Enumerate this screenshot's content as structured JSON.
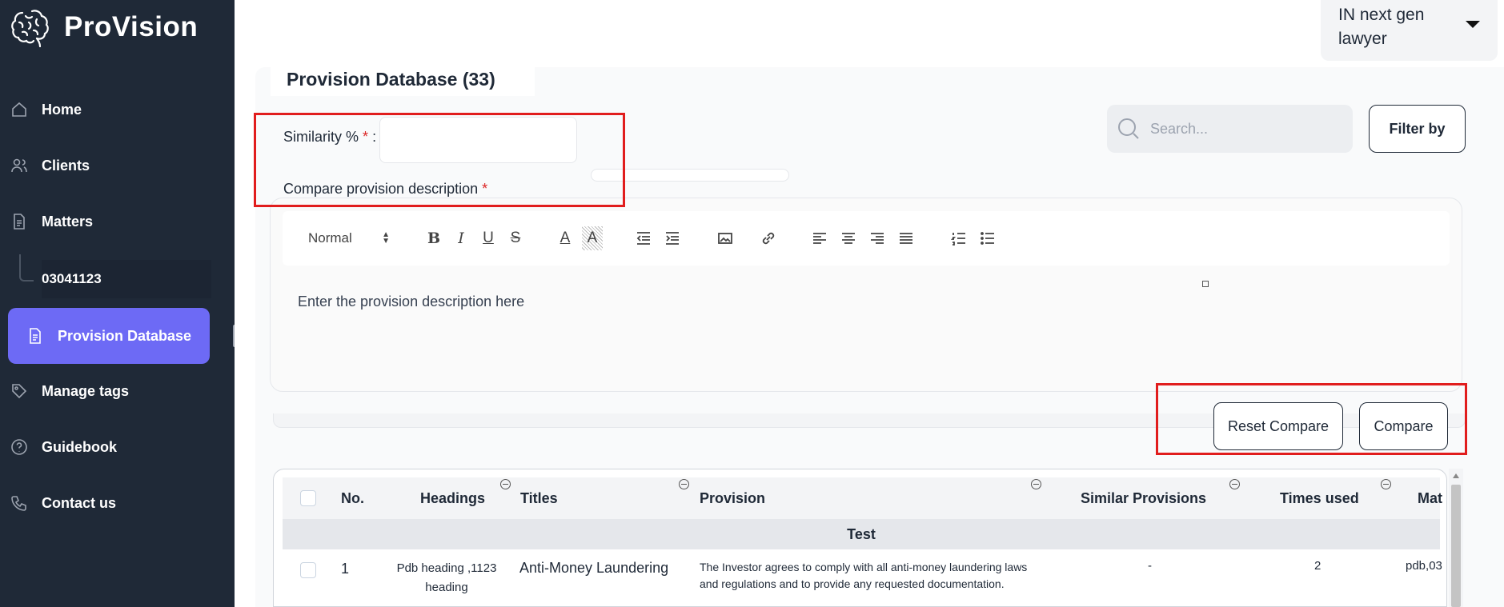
{
  "app": {
    "name": "ProVision"
  },
  "sidebar": {
    "items": [
      {
        "label": "Home",
        "icon": "home-icon"
      },
      {
        "label": "Clients",
        "icon": "users-icon"
      },
      {
        "label": "Matters",
        "icon": "document-icon"
      },
      {
        "label": "03041123",
        "icon": ""
      },
      {
        "label": "Provision Database",
        "icon": "file-icon",
        "active": true
      },
      {
        "label": "Manage tags",
        "icon": "tag-icon"
      },
      {
        "label": "Guidebook",
        "icon": "help-circle-icon"
      },
      {
        "label": "Contact us",
        "icon": "phone-icon"
      }
    ]
  },
  "user": {
    "name": "IN next gen lawyer"
  },
  "page": {
    "title": "Provision Database (33)"
  },
  "search": {
    "placeholder": "Search..."
  },
  "filter": {
    "label": "Filter by"
  },
  "form": {
    "similarity_label": "Similarity %",
    "similarity_colon": ":",
    "required_mark": "*",
    "similarity_value": "",
    "compare_label": "Compare provision description",
    "editor_placeholder": "Enter the provision description here"
  },
  "toolbar": {
    "format_select": "Normal",
    "tools": [
      "bold-icon",
      "italic-icon",
      "underline-icon",
      "strike-icon",
      "text-color-icon",
      "highlight-icon",
      "outdent-icon",
      "indent-icon",
      "image-icon",
      "link-icon",
      "align-left-icon",
      "align-center-icon",
      "align-right-icon",
      "align-justify-icon",
      "ordered-list-icon",
      "bullet-list-icon"
    ]
  },
  "buttons": {
    "reset_compare": "Reset Compare",
    "compare": "Compare"
  },
  "table": {
    "columns": [
      "No.",
      "Headings",
      "Titles",
      "Provision",
      "Similar Provisions",
      "Times used",
      "Mat"
    ],
    "group": "Test",
    "rows": [
      {
        "no": "1",
        "headings": "Pdb heading ,1123 heading",
        "title": "Anti-Money Laundering",
        "provision": "The Investor agrees to comply with all anti-money laundering laws and regulations and to provide any requested documentation.",
        "similar": "-",
        "times_used": "2",
        "matters": "pdb,03"
      }
    ]
  },
  "colors": {
    "sidebar_bg": "#1f2937",
    "active_bg": "#6d6af5",
    "highlight": "#e11d1d"
  }
}
